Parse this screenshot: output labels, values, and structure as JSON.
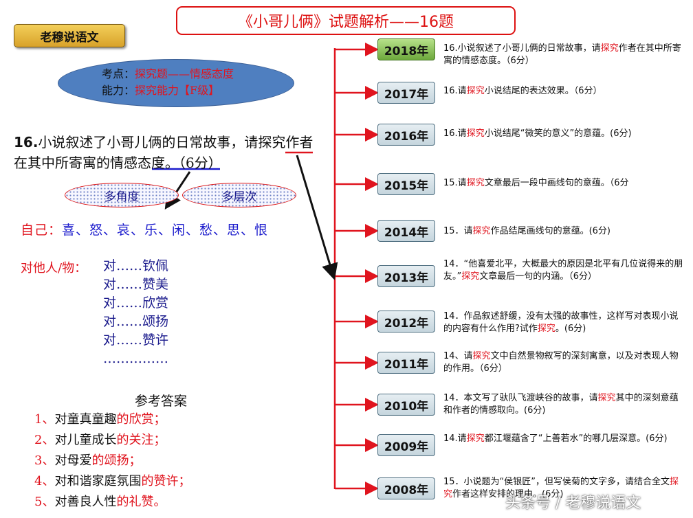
{
  "title": "《小哥儿俩》试题解析——16题",
  "brand": "老穆说语文",
  "kaodian": {
    "label": "考点：",
    "value": "探究题——情感态度"
  },
  "nengli": {
    "label": "能力：",
    "value": "探究能力【F级】"
  },
  "question": {
    "num": "16.",
    "part1": "小说叙述了小哥儿俩的日常故事，请探究作者在其中所寄寓的",
    "part2": "情感态度",
    "part3": "。（6分）"
  },
  "angles": [
    "多角度",
    "多层次"
  ],
  "self": {
    "label": "自己：",
    "items": "喜、怒、哀、乐、闲、愁、思、恨"
  },
  "others": {
    "label": "对他人/物：",
    "items": [
      "对……钦佩",
      "对……赞美",
      "对……欣赏",
      "对……颂扬",
      "对……赞许",
      "……………"
    ]
  },
  "answer": {
    "title": "参考答案",
    "items": [
      {
        "num": "1、",
        "a": "对童真童趣",
        "b": "的欣赏；"
      },
      {
        "num": "2、",
        "a": "对儿童成长",
        "b": "的关注；"
      },
      {
        "num": "3、",
        "a": "对母爱",
        "b": "的颂扬；"
      },
      {
        "num": "4、",
        "a": "对和谐家庭氛围",
        "b": "的赞许；"
      },
      {
        "num": "5、",
        "a": "对善良人性",
        "b": "的礼赞。"
      }
    ]
  },
  "years": [
    {
      "year": "2018年",
      "pre": "16.小说叙述了小哥儿俩的日常故事，请",
      "key": "探究",
      "post": "作者在其中所寄寓的情感态度。（6分）"
    },
    {
      "year": "2017年",
      "pre": "16.请",
      "key": "探究",
      "post": "小说结尾的表达效果。（6分）"
    },
    {
      "year": "2016年",
      "pre": "16.请",
      "key": "探究",
      "post": "小说结尾“微笑的意义”的意蕴。(6分)"
    },
    {
      "year": "2015年",
      "pre": "15.请",
      "key": "探究",
      "post": "文章最后一段中画线句的意蕴。（6分"
    },
    {
      "year": "2014年",
      "pre": "15．请",
      "key": "探究",
      "post": "作品结尾画线句的意蕴。(6分)"
    },
    {
      "year": "2013年",
      "pre": "14．“他喜爱北平，大概最大的原因是北平有几位说得来的朋友。”",
      "key": "探究",
      "post": "文章最后一句的内涵。（6分）"
    },
    {
      "year": "2012年",
      "pre": "14．作品叙述舒缓，没有太强的故事性，这样写对表现小说的内容有什么作用?试作",
      "key": "探究",
      "post": "。(6分)"
    },
    {
      "year": "2011年",
      "pre": "14、请",
      "key": "探究",
      "post": "文中自然景物叙写的深刻寓意，以及对表现人物的作用。（6分）"
    },
    {
      "year": "2010年",
      "pre": "14．本文写了驮队飞渡峡谷的故事，请",
      "key": "探究",
      "post": "其中的深刻意蕴和作者的情感取向。(6分)"
    },
    {
      "year": "2009年",
      "pre": "14.请",
      "key": "探究",
      "post": "都江堰蕴含了“上善若水”的哪几层深意。(6分)"
    },
    {
      "year": "2008年",
      "pre": "15．小说题为“侯银匠”，但写侯菊的文字多，请结合全文",
      "key": "探究",
      "post": "作者这样安排的理由。(6分)"
    }
  ],
  "watermark": "头条号 / 老穆说语文",
  "colors": {
    "accent_red": "#e0141e",
    "ellipse_blue": "#4f7fc0",
    "active_year": "#8cc659"
  }
}
